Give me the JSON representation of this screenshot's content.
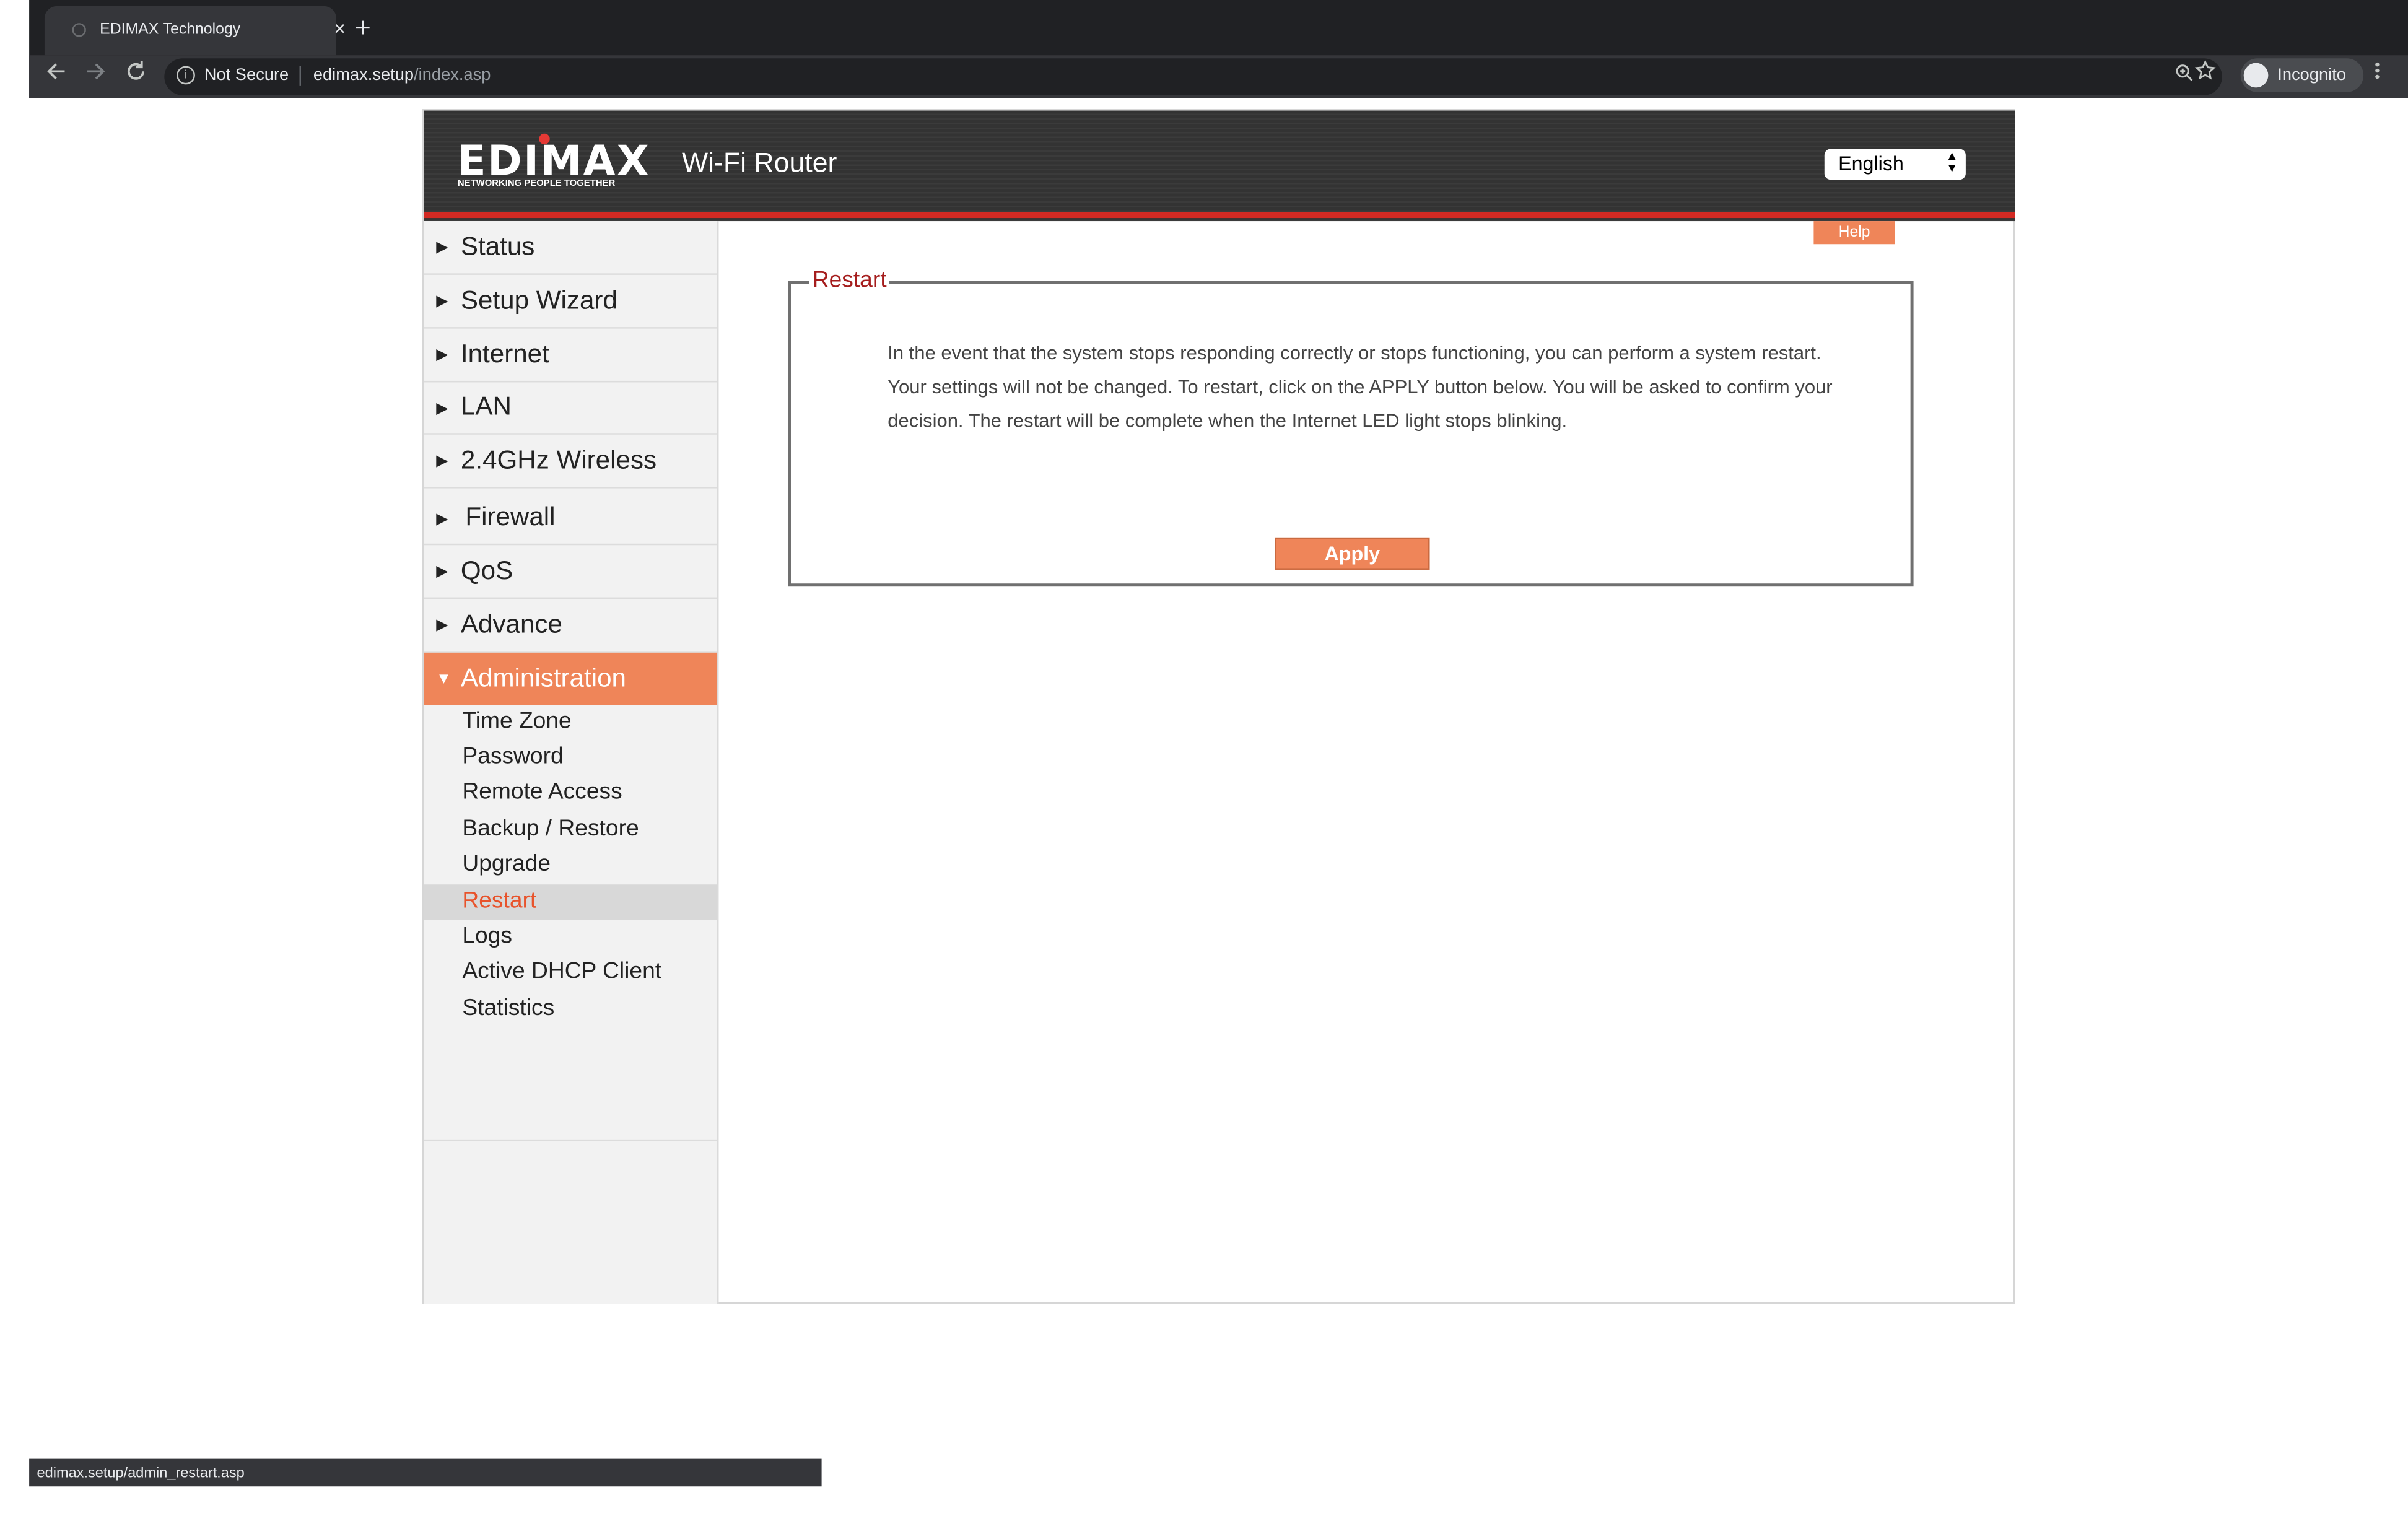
{
  "browser": {
    "tab_title": "EDIMAX Technology",
    "tab_close": "×",
    "new_tab": "+",
    "security_label": "Not Secure",
    "url_host": "edimax.setup",
    "url_path": "/index.asp",
    "profile_label": "Incognito",
    "icons": [
      "back-icon",
      "forward-icon",
      "reload-icon",
      "info-icon",
      "zoom-icon",
      "star-icon",
      "incognito-icon",
      "menu-icon"
    ]
  },
  "header": {
    "logo_text": "EDIMAX",
    "logo_tagline": "NETWORKING PEOPLE TOGETHER",
    "title": "Wi-Fi Router",
    "language": "English"
  },
  "colors": {
    "accent": "#ef8559",
    "header_bg": "#333333",
    "header_stripe": "#d32a23",
    "legend_text": "#a51d1d",
    "selected_text": "#e8532b"
  },
  "sidebar": {
    "items": [
      {
        "label": "Status"
      },
      {
        "label": "Setup Wizard"
      },
      {
        "label": "Internet"
      },
      {
        "label": "LAN"
      },
      {
        "label": "2.4GHz Wireless"
      },
      {
        "label": "Firewall"
      },
      {
        "label": "QoS"
      },
      {
        "label": "Advance"
      },
      {
        "label": "Administration"
      }
    ],
    "collapsed_arrow": "▶",
    "expanded_arrow": "▼",
    "subitems": [
      {
        "label": "Time Zone"
      },
      {
        "label": "Password"
      },
      {
        "label": "Remote Access"
      },
      {
        "label": "Backup / Restore"
      },
      {
        "label": "Upgrade"
      },
      {
        "label": "Restart"
      },
      {
        "label": "Logs"
      },
      {
        "label": "Active DHCP Client"
      },
      {
        "label": "Statistics"
      }
    ]
  },
  "main": {
    "help_label": "Help",
    "legend": "Restart",
    "description": "In the event that the system stops responding correctly or stops functioning, you can perform a system restart. Your settings will not be changed. To restart, click on the APPLY button below. You will be asked to confirm your decision. The restart will be complete when the Internet LED light stops blinking.",
    "apply_label": "Apply"
  },
  "statusbar": {
    "url": "edimax.setup/admin_restart.asp"
  }
}
